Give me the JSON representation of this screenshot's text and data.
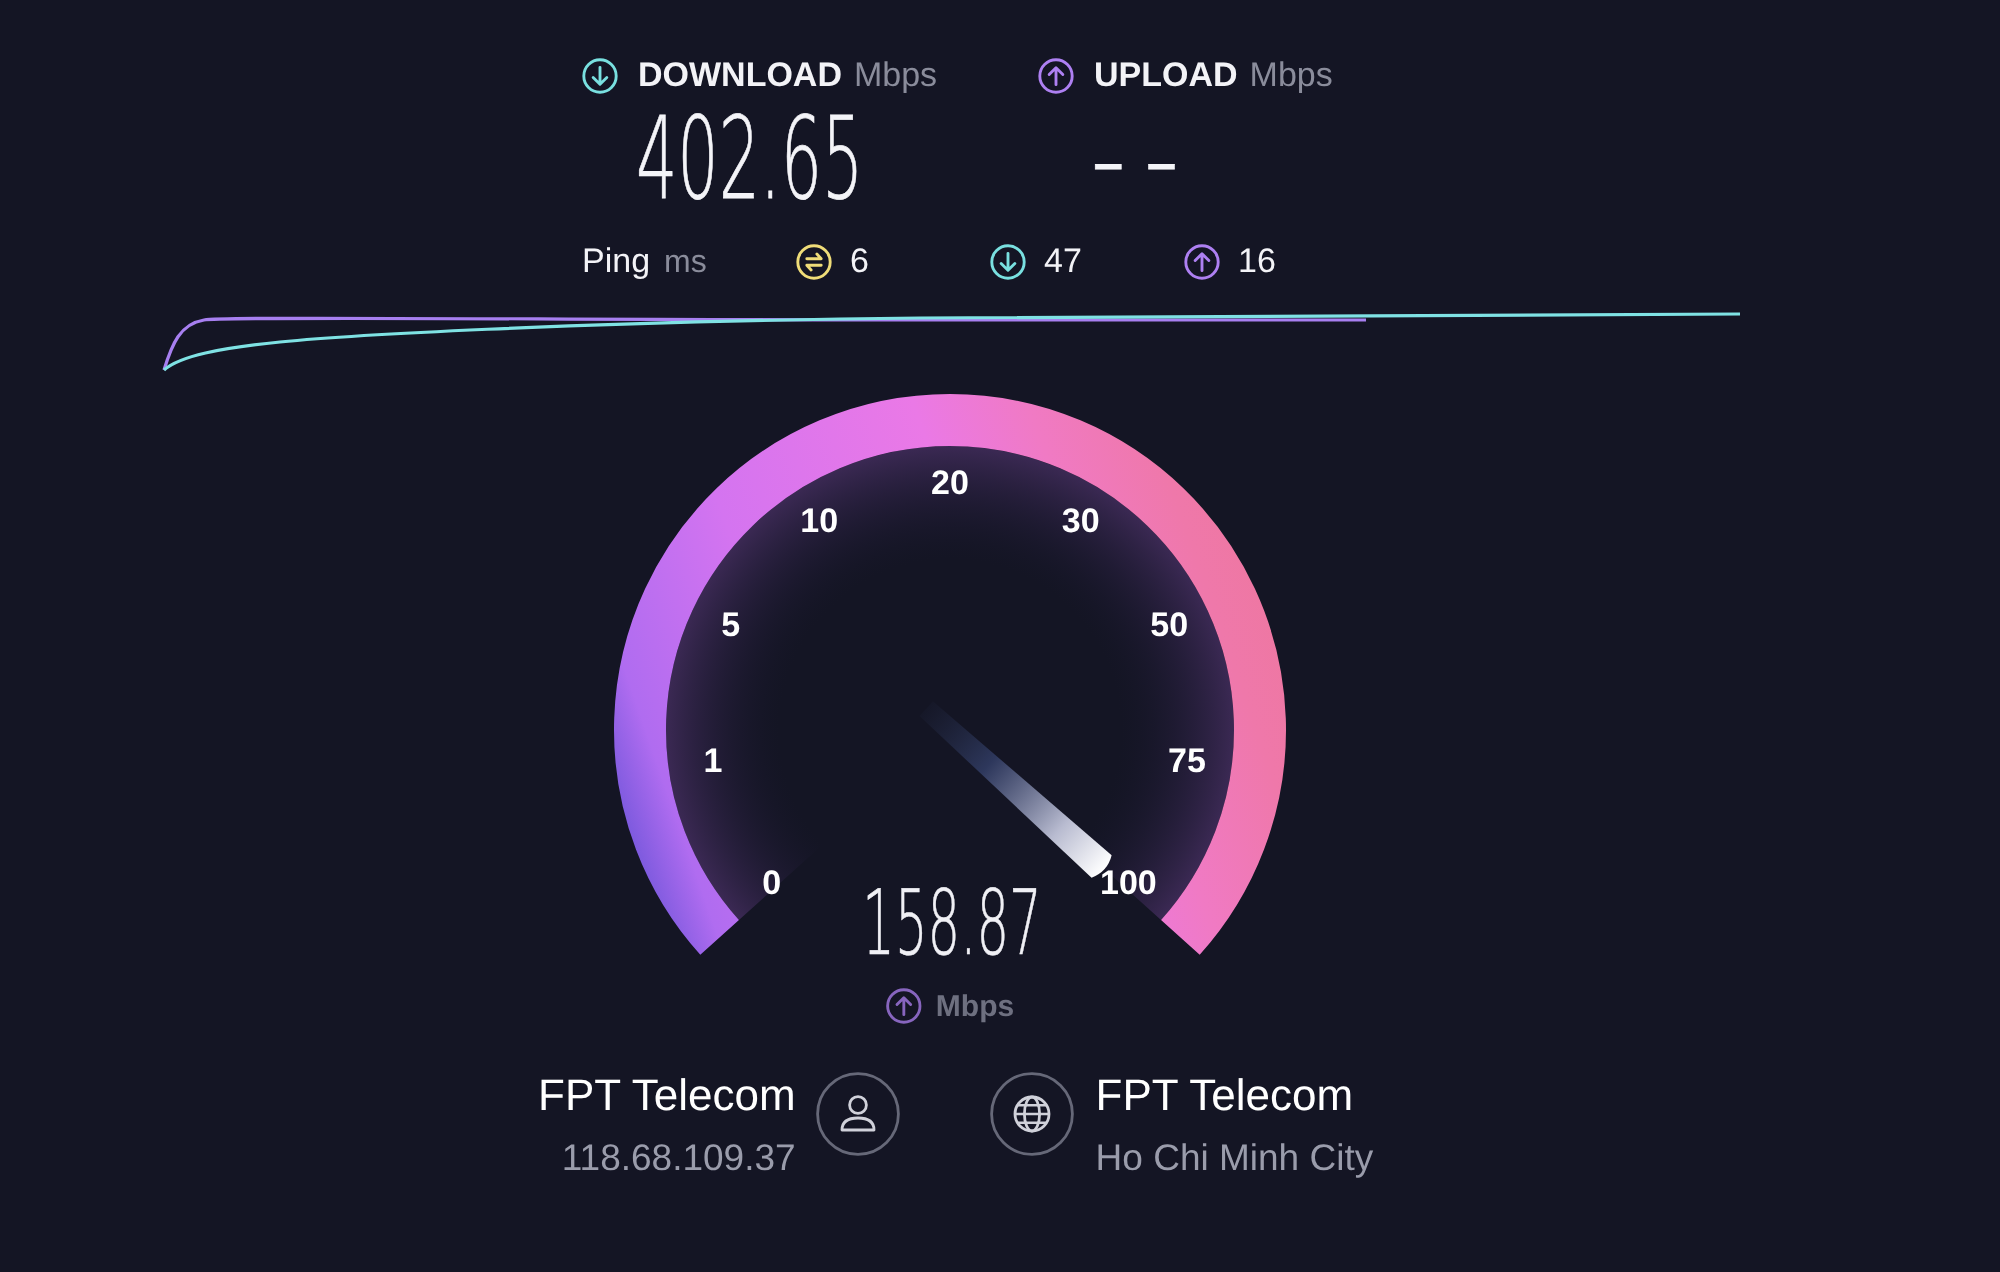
{
  "results": [
    {
      "kind": "download",
      "label": "DOWNLOAD",
      "unit": "Mbps",
      "value": "402.65"
    },
    {
      "kind": "upload",
      "label": "UPLOAD",
      "unit": "Mbps",
      "value": "– –"
    }
  ],
  "ping": {
    "label": "Ping",
    "unit": "ms",
    "stats": [
      {
        "kind": "idle",
        "value": "6"
      },
      {
        "kind": "download",
        "value": "47"
      },
      {
        "kind": "upload",
        "value": "16"
      }
    ]
  },
  "gauge": {
    "kind": "upload",
    "ticks": [
      "0",
      "1",
      "5",
      "10",
      "20",
      "30",
      "50",
      "75",
      "100"
    ],
    "value": "158.87",
    "unit": "Mbps"
  },
  "connection": {
    "client": {
      "name": "FPT Telecom",
      "address": "118.68.109.37"
    },
    "server": {
      "name": "FPT Telecom",
      "location": "Ho Chi Minh City"
    }
  }
}
